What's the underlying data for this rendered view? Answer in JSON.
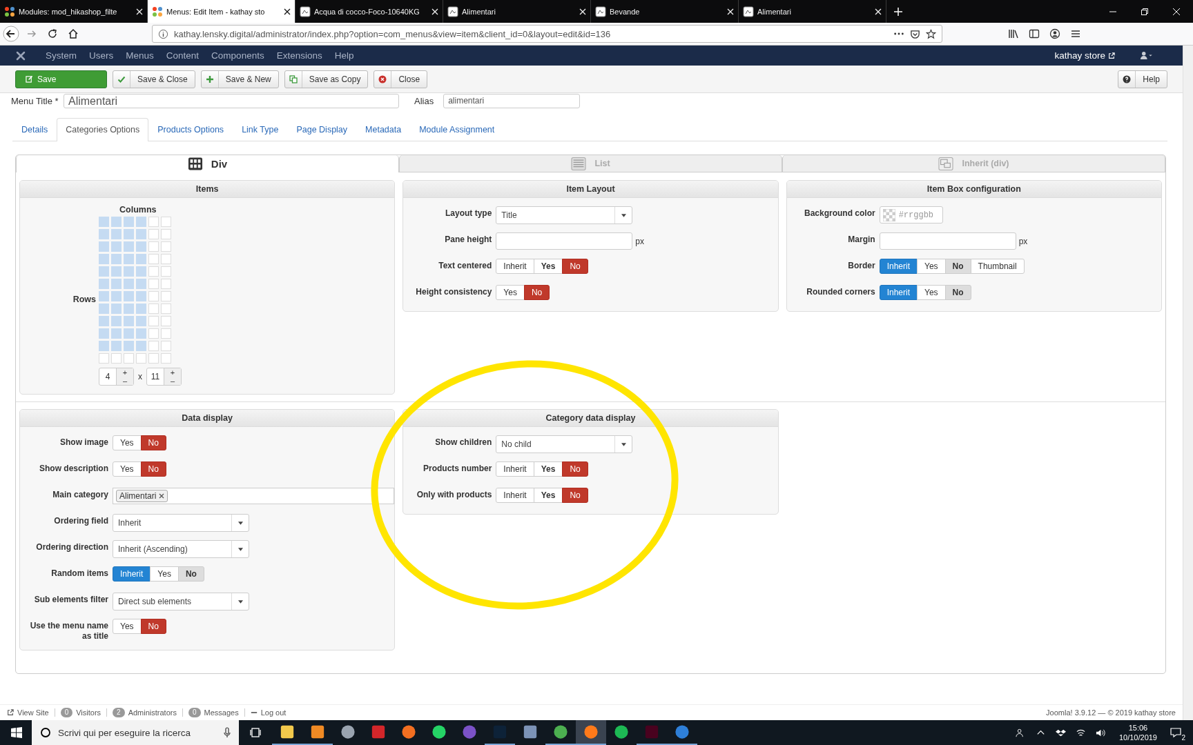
{
  "browser": {
    "tabs": [
      {
        "title": "Modules: mod_hikashop_filte",
        "kind": "joomla",
        "selected": false
      },
      {
        "title": "Menus: Edit Item - kathay sto",
        "kind": "joomla",
        "selected": true
      },
      {
        "title": "Acqua di cocco-Foco-10640KG",
        "kind": "page",
        "selected": false
      },
      {
        "title": "Alimentari",
        "kind": "page",
        "selected": false
      },
      {
        "title": "Bevande",
        "kind": "page",
        "selected": false
      },
      {
        "title": "Alimentari",
        "kind": "page",
        "selected": false
      }
    ],
    "url": "kathay.lensky.digital/administrator/index.php?option=com_menus&view=item&client_id=0&layout=edit&id=136"
  },
  "joomla": {
    "menu": [
      "System",
      "Users",
      "Menus",
      "Content",
      "Components",
      "Extensions",
      "Help"
    ],
    "site": "kathay store"
  },
  "toolbar": {
    "buttons": [
      {
        "label": "Save",
        "kind": "primary"
      },
      {
        "label": "Save & Close",
        "kind": "default"
      },
      {
        "label": "Save & New",
        "kind": "default"
      },
      {
        "label": "Save as Copy",
        "kind": "default"
      },
      {
        "label": "Close",
        "kind": "default"
      }
    ],
    "help": "Help"
  },
  "title_row": {
    "title_label": "Menu Title *",
    "title_value": "Alimentari",
    "alias_label": "Alias",
    "alias_value": "alimentari"
  },
  "tabs": [
    {
      "label": "Details",
      "selected": false
    },
    {
      "label": "Categories Options",
      "selected": true
    },
    {
      "label": "Products Options",
      "selected": false
    },
    {
      "label": "Link Type",
      "selected": false
    },
    {
      "label": "Page Display",
      "selected": false
    },
    {
      "label": "Metadata",
      "selected": false
    },
    {
      "label": "Module Assignment",
      "selected": false
    }
  ],
  "layouts": [
    {
      "label": "Div",
      "kind": "grid",
      "selected": true
    },
    {
      "label": "List",
      "kind": "list",
      "selected": false
    },
    {
      "label": "Inherit (div)",
      "kind": "inherit",
      "selected": false
    }
  ],
  "items": {
    "title": "Items",
    "columns_label": "Columns",
    "rows_label": "Rows",
    "columns_value": "4",
    "rows_value": "11",
    "plus": "+",
    "minus": "–",
    "times": "x",
    "grid": [
      [
        true,
        true,
        true,
        true,
        false,
        false
      ],
      [
        true,
        true,
        true,
        true,
        false,
        false
      ],
      [
        true,
        true,
        true,
        true,
        false,
        false
      ],
      [
        true,
        true,
        true,
        true,
        false,
        false
      ],
      [
        true,
        true,
        true,
        true,
        false,
        false
      ],
      [
        true,
        true,
        true,
        true,
        false,
        false
      ],
      [
        true,
        true,
        true,
        true,
        false,
        false
      ],
      [
        true,
        true,
        true,
        true,
        false,
        false
      ],
      [
        true,
        true,
        true,
        true,
        false,
        false
      ],
      [
        true,
        true,
        true,
        true,
        false,
        false
      ],
      [
        true,
        true,
        true,
        true,
        false,
        false
      ],
      [
        false,
        false,
        false,
        false,
        false,
        false
      ]
    ]
  },
  "panels": [
    {
      "title": "Item Layout",
      "rows": [
        {
          "label": "Layout type",
          "kind": "select",
          "value": "Title"
        },
        {
          "label": "Pane height",
          "kind": "input",
          "suffix": "px"
        },
        {
          "label": "Text centered",
          "kind": "toggle",
          "options": [
            {
              "label": "Inherit",
              "selected": false,
              "bold": false,
              "shaded": false
            },
            {
              "label": "Yes",
              "selected": false,
              "bold": true,
              "shaded": false
            },
            {
              "label": "No",
              "kind": "no",
              "selected": true,
              "bold": false,
              "shaded": false
            }
          ]
        },
        {
          "label": "Height consistency",
          "kind": "toggle",
          "options": [
            {
              "label": "Yes",
              "selected": false,
              "bold": false,
              "shaded": false
            },
            {
              "label": "No",
              "kind": "no",
              "selected": true,
              "bold": false,
              "shaded": false
            }
          ]
        }
      ]
    },
    {
      "title": "Item Box configuration",
      "rows": [
        {
          "label": "Background color",
          "kind": "color",
          "placeholder": "#rrggbb"
        },
        {
          "label": "Margin",
          "kind": "input",
          "suffix": "px"
        },
        {
          "label": "Border",
          "kind": "toggle",
          "options": [
            {
              "label": "Inherit",
              "kind": "inherit",
              "selected": true,
              "bold": false,
              "shaded": false
            },
            {
              "label": "Yes",
              "selected": false,
              "bold": false,
              "shaded": false
            },
            {
              "label": "No",
              "selected": false,
              "bold": true,
              "shaded": true
            },
            {
              "label": "Thumbnail",
              "selected": false,
              "bold": false,
              "shaded": false
            }
          ]
        },
        {
          "label": "Rounded corners",
          "kind": "toggle",
          "options": [
            {
              "label": "Inherit",
              "kind": "inherit",
              "selected": true,
              "bold": false,
              "shaded": false
            },
            {
              "label": "Yes",
              "selected": false,
              "bold": false,
              "shaded": false
            },
            {
              "label": "No",
              "selected": false,
              "bold": true,
              "shaded": true
            }
          ]
        }
      ]
    },
    {
      "title": "Data display",
      "rows": [
        {
          "label": "Show image",
          "kind": "toggle",
          "options": [
            {
              "label": "Yes",
              "selected": false,
              "bold": false,
              "shaded": false
            },
            {
              "label": "No",
              "kind": "no",
              "selected": true,
              "bold": false,
              "shaded": false
            }
          ]
        },
        {
          "label": "Show description",
          "kind": "toggle",
          "options": [
            {
              "label": "Yes",
              "selected": false,
              "bold": false,
              "shaded": false
            },
            {
              "label": "No",
              "kind": "no",
              "selected": true,
              "bold": false,
              "shaded": false
            }
          ]
        },
        {
          "label": "Main category",
          "kind": "tags",
          "tags": [
            "Alimentari"
          ]
        },
        {
          "label": "Ordering field",
          "kind": "select",
          "value": "Inherit"
        },
        {
          "label": "Ordering direction",
          "kind": "select",
          "value": "Inherit (Ascending)"
        },
        {
          "label": "Random items",
          "kind": "toggle",
          "options": [
            {
              "label": "Inherit",
              "kind": "inherit",
              "selected": true,
              "bold": false,
              "shaded": false
            },
            {
              "label": "Yes",
              "selected": false,
              "bold": false,
              "shaded": false
            },
            {
              "label": "No",
              "selected": false,
              "bold": true,
              "shaded": true
            }
          ]
        },
        {
          "label": "Sub elements filter",
          "kind": "select",
          "value": "Direct sub elements"
        },
        {
          "label": "Use the menu name as title",
          "kind": "toggle",
          "options": [
            {
              "label": "Yes",
              "selected": false,
              "bold": false,
              "shaded": false
            },
            {
              "label": "No",
              "kind": "no",
              "selected": true,
              "bold": false,
              "shaded": false
            }
          ]
        }
      ]
    },
    {
      "title": "Category data display",
      "rows": [
        {
          "label": "Show children",
          "kind": "select",
          "value": "No child"
        },
        {
          "label": "Products number",
          "kind": "toggle",
          "options": [
            {
              "label": "Inherit",
              "selected": false,
              "bold": false,
              "shaded": false
            },
            {
              "label": "Yes",
              "selected": false,
              "bold": true,
              "shaded": false
            },
            {
              "label": "No",
              "kind": "no",
              "selected": true,
              "bold": false,
              "shaded": false
            }
          ]
        },
        {
          "label": "Only with products",
          "kind": "toggle",
          "options": [
            {
              "label": "Inherit",
              "selected": false,
              "bold": false,
              "shaded": false
            },
            {
              "label": "Yes",
              "selected": false,
              "bold": true,
              "shaded": false
            },
            {
              "label": "No",
              "kind": "no",
              "selected": true,
              "bold": false,
              "shaded": false
            }
          ]
        }
      ]
    }
  ],
  "status_bar": {
    "items": [
      {
        "kind": "link",
        "label": "View Site"
      },
      {
        "kind": "badge",
        "badge": "0",
        "label": "Visitors"
      },
      {
        "kind": "badge",
        "badge": "2",
        "label": "Administrators"
      },
      {
        "kind": "badge",
        "badge": "0",
        "label": "Messages"
      },
      {
        "kind": "logout",
        "label": "Log out"
      }
    ],
    "right": "Joomla! 3.9.12 — © 2019 kathay store"
  },
  "taskbar": {
    "search_placeholder": "Scrivi qui per eseguire la ricerca",
    "apps": [
      {
        "kind": "folder",
        "running": true,
        "selected": false
      },
      {
        "kind": "mail",
        "running": true,
        "selected": false
      },
      {
        "kind": "round",
        "running": false,
        "selected": false
      },
      {
        "kind": "cloud",
        "running": false,
        "selected": false
      },
      {
        "kind": "shield",
        "running": false,
        "selected": false
      },
      {
        "kind": "chat",
        "running": false,
        "selected": false
      },
      {
        "kind": "skype",
        "running": false,
        "selected": false
      },
      {
        "kind": "photo",
        "running": true,
        "selected": false
      },
      {
        "kind": "badge",
        "running": false,
        "selected": false
      },
      {
        "kind": "chrome",
        "running": true,
        "selected": false
      },
      {
        "kind": "firefox",
        "running": true,
        "selected": true
      },
      {
        "kind": "music",
        "running": false,
        "selected": false
      },
      {
        "kind": "layout",
        "running": true,
        "selected": false
      },
      {
        "kind": "key",
        "running": true,
        "selected": false
      }
    ],
    "time": "15:06",
    "date": "10/10/2019",
    "notifications": "2"
  }
}
